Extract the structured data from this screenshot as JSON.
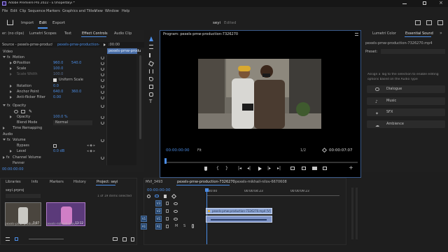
{
  "window": {
    "title": "Adobe Premiere Pro 2022 - E:\\mopeltalyi *"
  },
  "menu": [
    "File",
    "Edit",
    "Clip",
    "Sequence",
    "Markers",
    "Graphics and Titles",
    "View",
    "Window",
    "Help"
  ],
  "workspace": {
    "tabs": [
      "Import",
      "Edit",
      "Export"
    ],
    "active": "Edit",
    "center_title": "seyi",
    "center_subtitle": "Edited"
  },
  "left_panel": {
    "tabs": [
      "er: (no clips)",
      "Lumetri Scopes",
      "Text",
      "Effect Controls",
      "Audio Clip"
    ],
    "source_label": "Source - pexels-pmw-production-7...",
    "sequence_label": "pexels-pmw-production-73...",
    "timecode_start": ":00:00",
    "clip_label": "pexels-pmw-produ",
    "section_video": "Video",
    "section_audio": "Audio",
    "motion": "Motion",
    "position_label": "Position",
    "position_x": "960.0",
    "position_y": "540.0",
    "scale_label": "Scale",
    "scale_value": "100.0",
    "scale_width_label": "Scale Width",
    "scale_width_value": "100.0",
    "uniform_scale": "Uniform Scale",
    "rotation_label": "Rotation",
    "rotation_value": "0.0",
    "anchor_label": "Anchor Point",
    "anchor_x": "640.0",
    "anchor_y": "360.0",
    "antiflicker_label": "Anti-flicker Filter",
    "antiflicker_value": "0.00",
    "opacity": "Opacity",
    "opacity_label": "Opacity",
    "opacity_value": "100.0 %",
    "blend_label": "Blend Mode",
    "blend_value": "Normal",
    "time_remap": "Time Remapping",
    "volume": "Volume",
    "bypass_label": "Bypass",
    "level_label": "Level",
    "level_value": "0.0 dB",
    "channel_volume": "Channel Volume",
    "panner": "Panner",
    "timecode_bottom": "00:00:00:00"
  },
  "program": {
    "title": "Program: pexels-pmw-production-7326270",
    "timecode_left": "00:00:00:00",
    "fit": "Fit",
    "resolution": "1/2",
    "timecode_right": "00:00:07:07"
  },
  "right_panel": {
    "tabs": [
      "Lumetri Color",
      "Essential Sound"
    ],
    "clip_name": "pexels-pmw-production-7326270.mp4",
    "preset_label": "Preset:",
    "help_text_line1": "Assign a Tag to the selection to enable editing",
    "help_text_line2": "options based on the Audio Type",
    "buttons": [
      "Dialogue",
      "Music",
      "SFX",
      "Ambience"
    ]
  },
  "project_panel": {
    "tabs": [
      "Libraries",
      "Info",
      "Markers",
      "History",
      "Project: seyi"
    ],
    "project_file": "seyi.prproj",
    "items_selected": "1 of 19 items selected",
    "clip1_name": "pexels-pmw-producti...",
    "clip1_duration": "7:07",
    "clip2_name": "pexels-mikhail-nilov...",
    "clip2_duration": "13:12"
  },
  "timeline": {
    "tabs": [
      "MVI_3493",
      "pexels-pmw-production-7326270",
      "pexels-mikhail-nilov-6670608"
    ],
    "timecode": "00:00:00:00",
    "ruler": [
      ":00:00",
      "00:00:04:23",
      "00:00:09:23"
    ],
    "video_tracks": [
      "V3",
      "V2",
      "V1"
    ],
    "audio_tracks": [
      "A1"
    ],
    "video_clip": "pexels-pmw-production-7326270.mp4 [V]"
  },
  "colors": {
    "accent_blue": "#4b8de6",
    "clip_video": "#8fa7d6",
    "clip_audio": "#7d93c8",
    "playhead": "#4b8de6"
  }
}
